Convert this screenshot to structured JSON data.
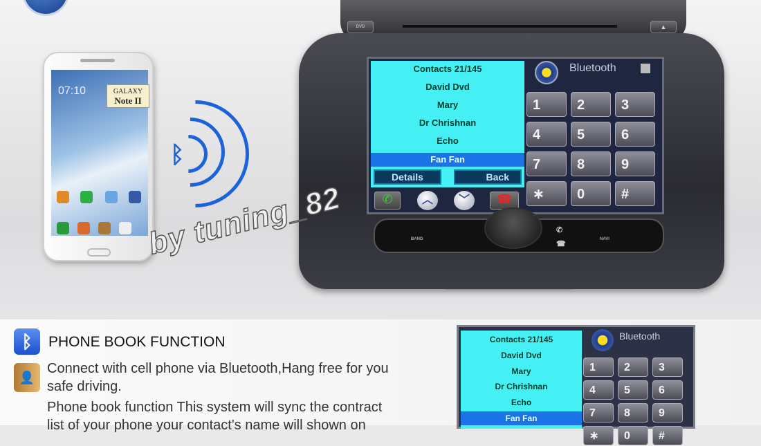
{
  "phone": {
    "clock": "07:10",
    "badge_line1": "GALAXY",
    "badge_line2": "Note II"
  },
  "head_unit": {
    "dvd_label": "DVD",
    "eject_label": "▲",
    "contacts": {
      "header": "Contacts  21/145",
      "items": [
        "David Dvd",
        "Mary",
        "Dr Chrishnan",
        "Echo",
        "Fan Fan"
      ],
      "selected": "Fan Fan"
    },
    "details_label": "Details",
    "back_label": "Back",
    "bluetooth_label": "Bluetooth",
    "keypad": [
      "1",
      "2",
      "3",
      "4",
      "5",
      "6",
      "7",
      "8",
      "9",
      "∗",
      "0",
      "#"
    ],
    "controls": {
      "band": "BAND",
      "navi": "NAVI"
    }
  },
  "watermark": "by tuning_82",
  "feature": {
    "title": "PHONE BOOK FUNCTION",
    "lines": [
      "Connect with cell phone via Bluetooth,Hang free for you",
      "safe driving.",
      "Phone book function This system will sync the contract",
      "list of your phone your contact's name will shown on"
    ]
  },
  "colors": {
    "list_bg": "#44f0f4",
    "selected_row": "#1a74e8",
    "bluetooth_blue": "#1b63d8"
  }
}
